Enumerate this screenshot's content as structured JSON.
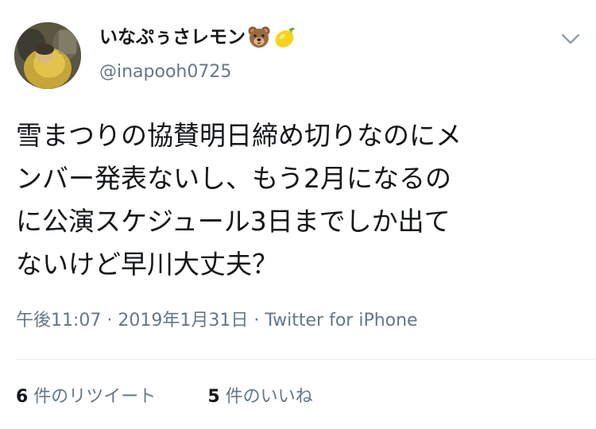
{
  "user": {
    "display_name": "いなぷぅさレモン",
    "emoji_icons": [
      "bear-face",
      "lemon"
    ],
    "handle": "@inapooh0725"
  },
  "tweet": {
    "lines": [
      "雪まつりの協賛明日締め切りなのにメ",
      "ンバー発表ないし、もう2月になるの",
      "に公演スケジュール3日までしか出て",
      "ないけど早川大丈夫？"
    ]
  },
  "meta": {
    "time": "午後11:07",
    "separator": " · ",
    "date": "2019年1月31日",
    "source": "Twitter for iPhone"
  },
  "stats": {
    "retweets_count": "6",
    "retweets_label": " 件のリツイート",
    "likes_count": "5",
    "likes_label": " 件のいいね"
  },
  "colors": {
    "text": "#14171a",
    "secondary": "#657786",
    "divider": "#e6ecf0"
  }
}
